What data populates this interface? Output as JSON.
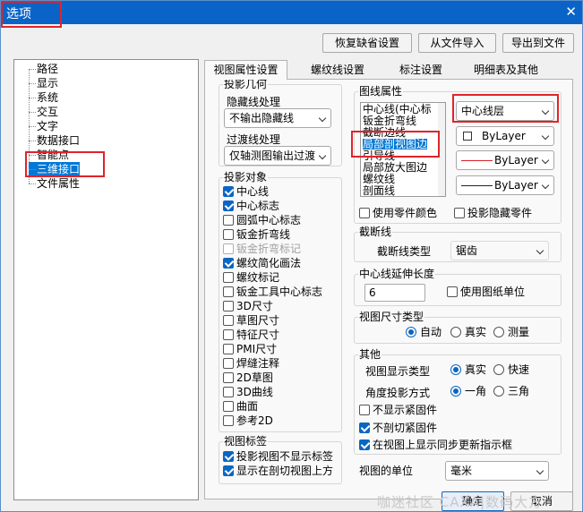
{
  "window": {
    "title": "选项",
    "close_glyph": "✕"
  },
  "top_buttons": {
    "restore": "恢复缺省设置",
    "import": "从文件导入",
    "export": "导出到文件"
  },
  "tree": {
    "items": [
      "路径",
      "显示",
      "系统",
      "交互",
      "文字",
      "数据接口",
      "智能点",
      "三维接口",
      "文件属性"
    ],
    "selected": "三维接口"
  },
  "tabs": [
    "视图属性设置",
    "螺纹线设置",
    "标注设置",
    "明细表及其他"
  ],
  "projection_geometry": {
    "title": "投影几何",
    "hidden_label": "隐藏线处理",
    "hidden_value": "不输出隐藏线",
    "transition_label": "过渡线处理",
    "transition_value": "仅轴测图输出过渡"
  },
  "projection_objects": {
    "title": "投影对象",
    "items": [
      "中心线",
      "中心标志",
      "圆弧中心标志",
      "钣金折弯线",
      "钣金折弯标记",
      "螺纹简化画法",
      "螺纹标记",
      "钣金工具中心标志",
      "3D尺寸",
      "草图尺寸",
      "特征尺寸",
      "PMI尺寸",
      "焊缝注释",
      "2D草图",
      "3D曲线",
      "曲面",
      "参考2D"
    ]
  },
  "view_label": {
    "title": "视图标签",
    "items": [
      "投影视图不显示标签",
      "显示在剖切视图上方"
    ]
  },
  "line_props": {
    "title": "图线属性",
    "list": [
      "中心线(中心标",
      "钣金折弯线",
      "截断边线",
      "局部剖视图边",
      "引导线",
      "局部放大图边",
      "螺纹线",
      "剖面线"
    ],
    "selected": "局部剖视图边",
    "layer": "中心线层",
    "color": "ByLayer",
    "linetype": "ByLayer",
    "lineweight": "ByLayer",
    "use_part_color": "使用零件颜色",
    "project_hidden": "投影隐藏零件"
  },
  "break_line": {
    "title": "截断线",
    "type_label": "截断线类型",
    "type_value": "锯齿"
  },
  "center_ext": {
    "title": "中心线延伸长度",
    "value": "6",
    "use_drawing_unit": "使用图纸单位"
  },
  "dim_type": {
    "title": "视图尺寸类型",
    "options": [
      "自动",
      "真实",
      "测量"
    ],
    "selected": "自动"
  },
  "other": {
    "title": "其他",
    "display_label": "视图显示类型",
    "display_options": [
      "真实",
      "快速"
    ],
    "display_selected": "真实",
    "angle_label": "角度投影方式",
    "angle_options": [
      "一角",
      "三角"
    ],
    "angle_selected": "一角",
    "no_fastener": "不显示紧固件",
    "no_cut_fastener": "不剖切紧固件",
    "show_sync": "在视图上显示同步更新指示框"
  },
  "unit": {
    "label": "视图的单位",
    "value": "毫米"
  },
  "footer": {
    "ok": "确定",
    "cancel": "取消"
  },
  "watermark": "咖迷社区 CAXA|数码大方",
  "colors": {
    "title_bar": "#0a64c8",
    "highlight": "#0078d7",
    "red_annotation": "#e0242a",
    "check": "#0a66c2"
  }
}
